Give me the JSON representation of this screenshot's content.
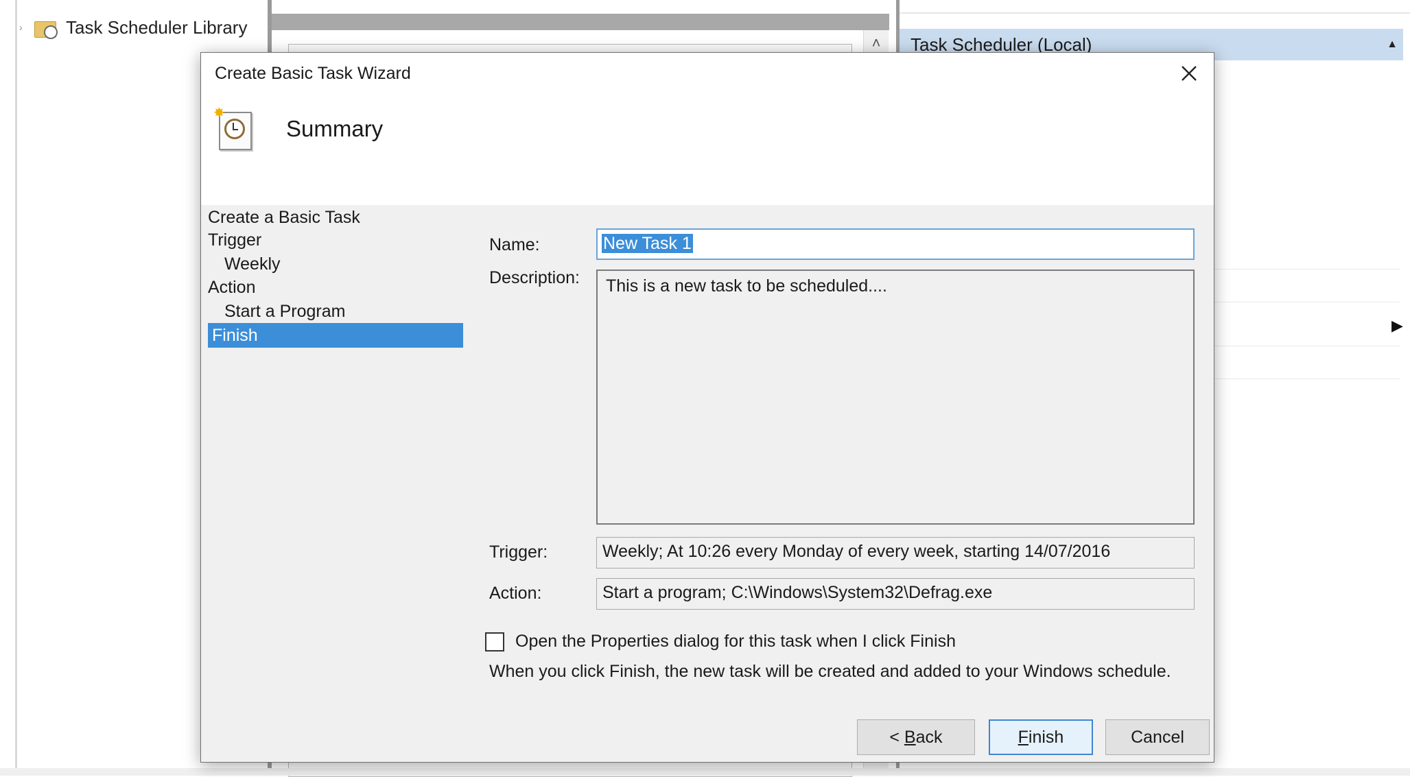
{
  "background": {
    "tree": {
      "item_label": "Task Scheduler Library"
    },
    "actions_pane": {
      "header": "Task Scheduler (Local)"
    }
  },
  "dialog": {
    "title": "Create Basic Task Wizard",
    "heading": "Summary",
    "steps": [
      {
        "label": "Create a Basic Task",
        "level": 0,
        "selected": false
      },
      {
        "label": "Trigger",
        "level": 0,
        "selected": false
      },
      {
        "label": "Weekly",
        "level": 1,
        "selected": false
      },
      {
        "label": "Action",
        "level": 0,
        "selected": false
      },
      {
        "label": "Start a Program",
        "level": 1,
        "selected": false
      },
      {
        "label": "Finish",
        "level": 0,
        "selected": true
      }
    ],
    "fields": {
      "name_label": "Name:",
      "name_value": "New Task 1",
      "description_label": "Description:",
      "description_value": "This is a new task to be scheduled....",
      "trigger_label": "Trigger:",
      "trigger_value": "Weekly; At 10:26 every Monday of every week, starting 14/07/2016",
      "action_label": "Action:",
      "action_value": "Start a program; C:\\Windows\\System32\\Defrag.exe"
    },
    "checkbox": {
      "label": "Open the Properties dialog for this task when I click Finish",
      "checked": false
    },
    "note": "When you click Finish, the new task will be created and added to your Windows schedule.",
    "buttons": {
      "back": {
        "prefix": "< ",
        "mnemonic": "B",
        "rest": "ack"
      },
      "finish": {
        "mnemonic": "F",
        "rest": "inish"
      },
      "cancel": "Cancel"
    }
  },
  "colors": {
    "selection": "#3c8ed8",
    "actions_header": "#c9dcef",
    "default_button_border": "#3f86d0"
  }
}
